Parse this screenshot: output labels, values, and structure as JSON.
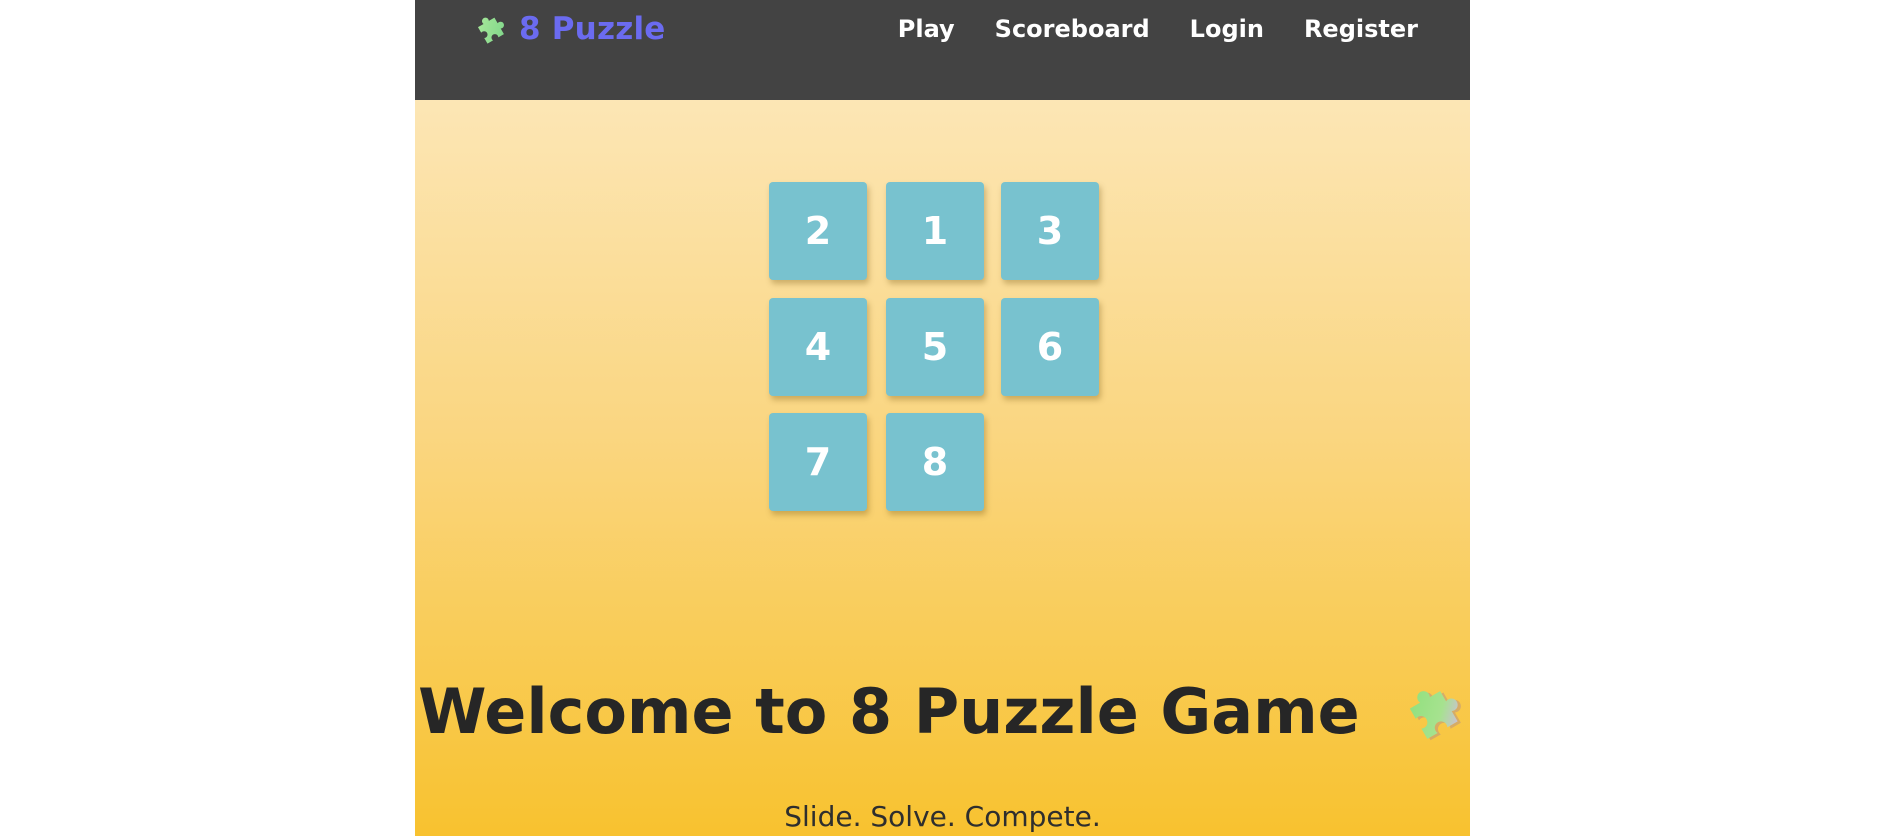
{
  "navbar": {
    "brand": {
      "icon": "puzzle-piece-icon",
      "label": "8 Puzzle",
      "color": "#6b6bf0"
    },
    "links": [
      {
        "label": "Play"
      },
      {
        "label": "Scoreboard"
      },
      {
        "label": "Login"
      },
      {
        "label": "Register"
      }
    ],
    "background": "#434343"
  },
  "board": {
    "tiles": [
      "2",
      "1",
      "3",
      "4",
      "5",
      "6",
      "7",
      "8",
      ""
    ],
    "tile_color": "#78c2cf"
  },
  "hero": {
    "title": "Welcome to 8 Puzzle Game",
    "title_icon": "puzzle-piece-icon",
    "tagline": "Slide. Solve. Compete."
  }
}
